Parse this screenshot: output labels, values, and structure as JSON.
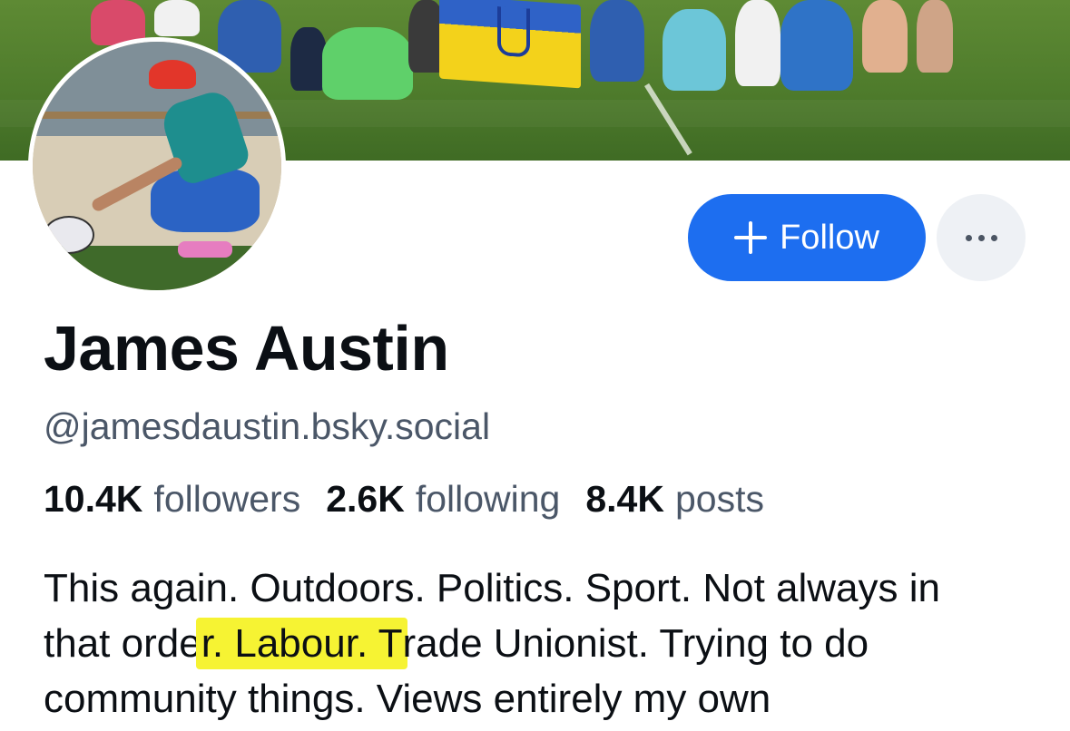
{
  "profile": {
    "display_name": "James Austin",
    "handle": "@jamesdaustin.bsky.social",
    "stats": {
      "followers_count": "10.4K",
      "followers_label": "followers",
      "following_count": "2.6K",
      "following_label": "following",
      "posts_count": "8.4K",
      "posts_label": "posts"
    },
    "bio": {
      "line1": "This again. Outdoors. Politics. Sport. Not always in",
      "line2_before": "that orde",
      "line2_highlight": "r. Labour. T",
      "line2_after": "rade Unionist. Trying to do",
      "line3": "community things. Views entirely my own"
    }
  },
  "actions": {
    "follow_label": "Follow",
    "follow_icon": "plus-icon",
    "more_icon": "dots-horizontal-icon"
  },
  "colors": {
    "accent": "#1d6ef0",
    "highlight": "#f6f333",
    "secondary_text": "#4b5768"
  }
}
